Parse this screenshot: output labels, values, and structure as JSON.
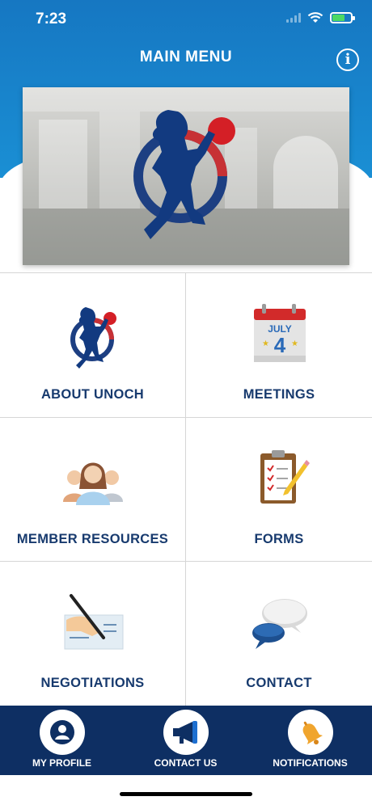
{
  "status": {
    "time": "7:23"
  },
  "header": {
    "title": "MAIN MENU",
    "info_icon": "info-circle-icon"
  },
  "menu": [
    {
      "label": "ABOUT UNOCH",
      "icon": "unoch-logo-icon"
    },
    {
      "label": "MEETINGS",
      "icon": "calendar-icon"
    },
    {
      "label": "MEMBER RESOURCES",
      "icon": "people-group-icon"
    },
    {
      "label": "FORMS",
      "icon": "clipboard-checklist-icon"
    },
    {
      "label": "NEGOTIATIONS",
      "icon": "signing-pen-icon"
    },
    {
      "label": "CONTACT",
      "icon": "speech-bubbles-icon"
    }
  ],
  "calendar": {
    "month": "JULY",
    "day": "4"
  },
  "tabbar": [
    {
      "label": "MY PROFILE",
      "icon": "user-circle-icon"
    },
    {
      "label": "CONTACT US",
      "icon": "megaphone-icon"
    },
    {
      "label": "NOTIFICATIONS",
      "icon": "bell-icon"
    }
  ],
  "colors": {
    "header": "#1a8fd4",
    "navy": "#0e2f63",
    "label": "#173a6e",
    "accent_red": "#d41f26"
  }
}
